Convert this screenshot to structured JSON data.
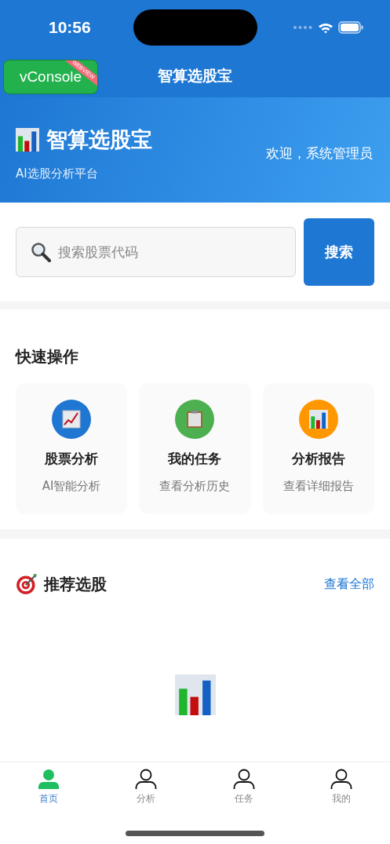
{
  "status_bar": {
    "time": "10:56"
  },
  "nav_bar": {
    "title": "智算选股宝",
    "debug_button": {
      "label": "vConsole",
      "ribbon": "WEBVIEW"
    }
  },
  "header": {
    "title": "智算选股宝",
    "subtitle": "AI选股分析平台",
    "welcome": "欢迎，系统管理员"
  },
  "search": {
    "placeholder": "搜索股票代码",
    "button": "搜索"
  },
  "quick_actions": {
    "title": "快速操作",
    "items": [
      {
        "kind": "line-chart",
        "title": "股票分析",
        "subtitle": "AI智能分析",
        "color": "#1f76d3"
      },
      {
        "kind": "clipboard",
        "title": "我的任务",
        "subtitle": "查看分析历史",
        "color": "#4caf50"
      },
      {
        "kind": "bar-chart",
        "title": "分析报告",
        "subtitle": "查看详细报告",
        "color": "#ff9800"
      }
    ]
  },
  "recommended": {
    "title": "推荐选股",
    "link": "查看全部"
  },
  "tab_bar": [
    {
      "label": "首页",
      "selected": true
    },
    {
      "label": "分析",
      "selected": false
    },
    {
      "label": "任务",
      "selected": false
    },
    {
      "label": "我的",
      "selected": false
    }
  ]
}
